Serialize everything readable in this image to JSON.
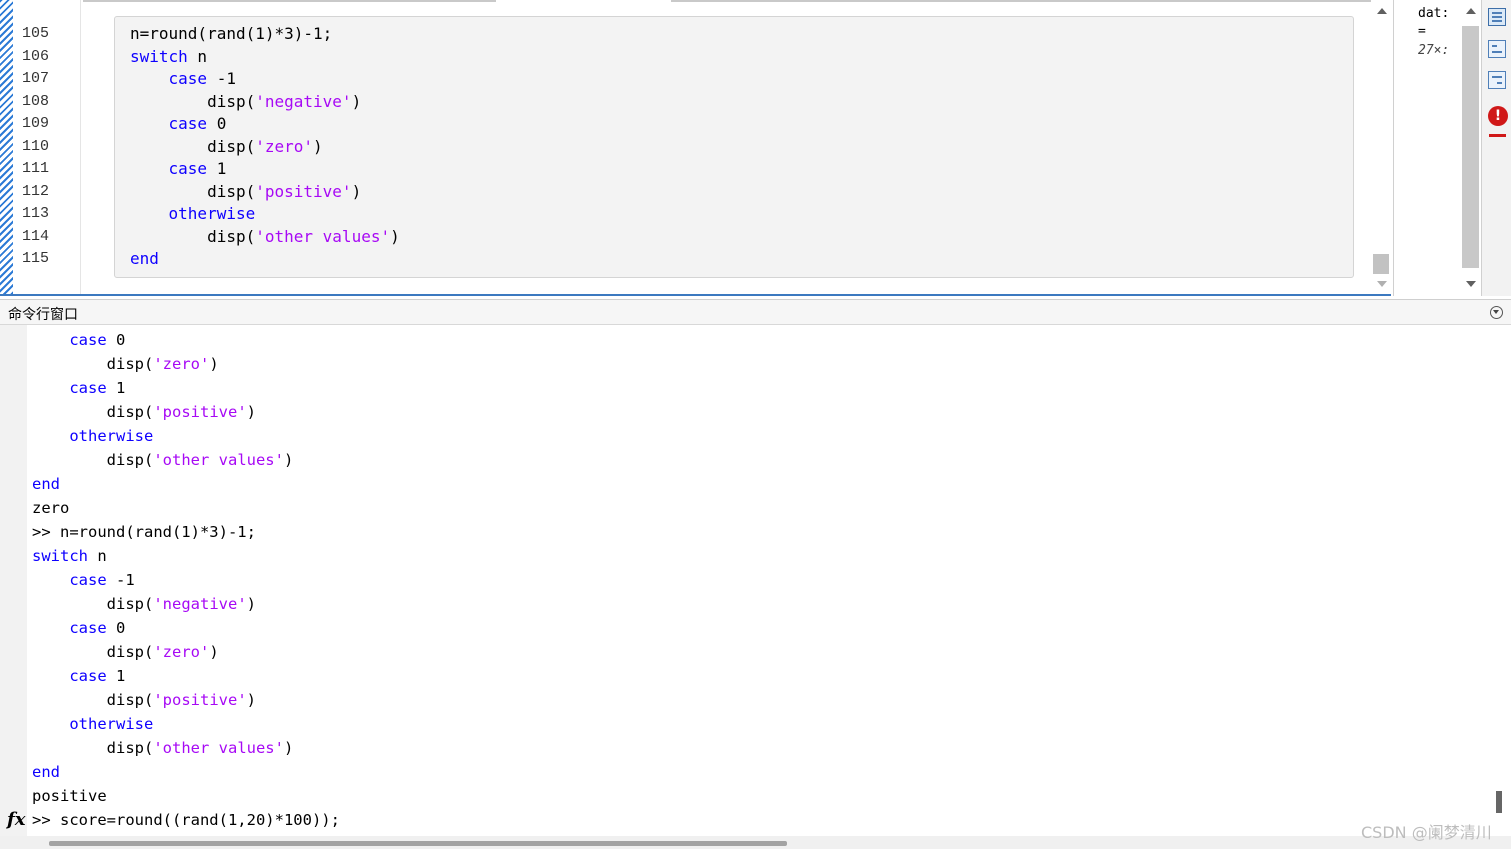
{
  "editor": {
    "line_numbers": [
      "105",
      "106",
      "107",
      "108",
      "109",
      "110",
      "111",
      "112",
      "113",
      "114",
      "115"
    ],
    "lines": [
      [
        {
          "t": "n=round(rand(1)*3)-1;",
          "c": "plain"
        }
      ],
      [
        {
          "t": "switch",
          "c": "kw"
        },
        {
          "t": " n",
          "c": "plain"
        }
      ],
      [
        {
          "t": "    ",
          "c": "plain"
        },
        {
          "t": "case",
          "c": "kw"
        },
        {
          "t": " -1",
          "c": "plain"
        }
      ],
      [
        {
          "t": "        disp(",
          "c": "plain"
        },
        {
          "t": "'negative'",
          "c": "str"
        },
        {
          "t": ")",
          "c": "plain"
        }
      ],
      [
        {
          "t": "    ",
          "c": "plain"
        },
        {
          "t": "case",
          "c": "kw"
        },
        {
          "t": " 0",
          "c": "plain"
        }
      ],
      [
        {
          "t": "        disp(",
          "c": "plain"
        },
        {
          "t": "'zero'",
          "c": "str"
        },
        {
          "t": ")",
          "c": "plain"
        }
      ],
      [
        {
          "t": "    ",
          "c": "plain"
        },
        {
          "t": "case",
          "c": "kw"
        },
        {
          "t": " 1",
          "c": "plain"
        }
      ],
      [
        {
          "t": "        disp(",
          "c": "plain"
        },
        {
          "t": "'positive'",
          "c": "str"
        },
        {
          "t": ")",
          "c": "plain"
        }
      ],
      [
        {
          "t": "    ",
          "c": "plain"
        },
        {
          "t": "otherwise",
          "c": "kw"
        }
      ],
      [
        {
          "t": "        disp(",
          "c": "plain"
        },
        {
          "t": "'other values'",
          "c": "str"
        },
        {
          "t": ")",
          "c": "plain"
        }
      ],
      [
        {
          "t": "end",
          "c": "kw"
        }
      ]
    ]
  },
  "workspace": {
    "var_name": "dat:",
    "equals": "=",
    "size": "27×:"
  },
  "toolbar": {
    "error_glyph": "!"
  },
  "command_window": {
    "title": "命令行窗口",
    "prompt_icon": "fx",
    "lines": [
      [
        {
          "t": "    ",
          "c": "plain"
        },
        {
          "t": "case",
          "c": "kw"
        },
        {
          "t": " 0",
          "c": "plain"
        }
      ],
      [
        {
          "t": "        disp(",
          "c": "plain"
        },
        {
          "t": "'zero'",
          "c": "str"
        },
        {
          "t": ")",
          "c": "plain"
        }
      ],
      [
        {
          "t": "    ",
          "c": "plain"
        },
        {
          "t": "case",
          "c": "kw"
        },
        {
          "t": " 1",
          "c": "plain"
        }
      ],
      [
        {
          "t": "        disp(",
          "c": "plain"
        },
        {
          "t": "'positive'",
          "c": "str"
        },
        {
          "t": ")",
          "c": "plain"
        }
      ],
      [
        {
          "t": "    ",
          "c": "plain"
        },
        {
          "t": "otherwise",
          "c": "kw"
        }
      ],
      [
        {
          "t": "        disp(",
          "c": "plain"
        },
        {
          "t": "'other values'",
          "c": "str"
        },
        {
          "t": ")",
          "c": "plain"
        }
      ],
      [
        {
          "t": "end",
          "c": "kw"
        }
      ],
      [
        {
          "t": "zero",
          "c": "plain"
        }
      ],
      [
        {
          "t": ">> n=round(rand(1)*3)-1;",
          "c": "plain"
        }
      ],
      [
        {
          "t": "switch",
          "c": "kw"
        },
        {
          "t": " n",
          "c": "plain"
        }
      ],
      [
        {
          "t": "    ",
          "c": "plain"
        },
        {
          "t": "case",
          "c": "kw"
        },
        {
          "t": " -1",
          "c": "plain"
        }
      ],
      [
        {
          "t": "        disp(",
          "c": "plain"
        },
        {
          "t": "'negative'",
          "c": "str"
        },
        {
          "t": ")",
          "c": "plain"
        }
      ],
      [
        {
          "t": "    ",
          "c": "plain"
        },
        {
          "t": "case",
          "c": "kw"
        },
        {
          "t": " 0",
          "c": "plain"
        }
      ],
      [
        {
          "t": "        disp(",
          "c": "plain"
        },
        {
          "t": "'zero'",
          "c": "str"
        },
        {
          "t": ")",
          "c": "plain"
        }
      ],
      [
        {
          "t": "    ",
          "c": "plain"
        },
        {
          "t": "case",
          "c": "kw"
        },
        {
          "t": " 1",
          "c": "plain"
        }
      ],
      [
        {
          "t": "        disp(",
          "c": "plain"
        },
        {
          "t": "'positive'",
          "c": "str"
        },
        {
          "t": ")",
          "c": "plain"
        }
      ],
      [
        {
          "t": "    ",
          "c": "plain"
        },
        {
          "t": "otherwise",
          "c": "kw"
        }
      ],
      [
        {
          "t": "        disp(",
          "c": "plain"
        },
        {
          "t": "'other values'",
          "c": "str"
        },
        {
          "t": ")",
          "c": "plain"
        }
      ],
      [
        {
          "t": "end",
          "c": "kw"
        }
      ],
      [
        {
          "t": "positive",
          "c": "plain"
        }
      ],
      [
        {
          "t": ">> score=round((rand(1,20)*100));",
          "c": "plain"
        }
      ]
    ]
  },
  "watermark": "CSDN @阑梦清川",
  "colors": {
    "keyword": "#0e00ff",
    "string": "#a709f5",
    "accent": "#2d7bd6",
    "error": "#d01818"
  }
}
